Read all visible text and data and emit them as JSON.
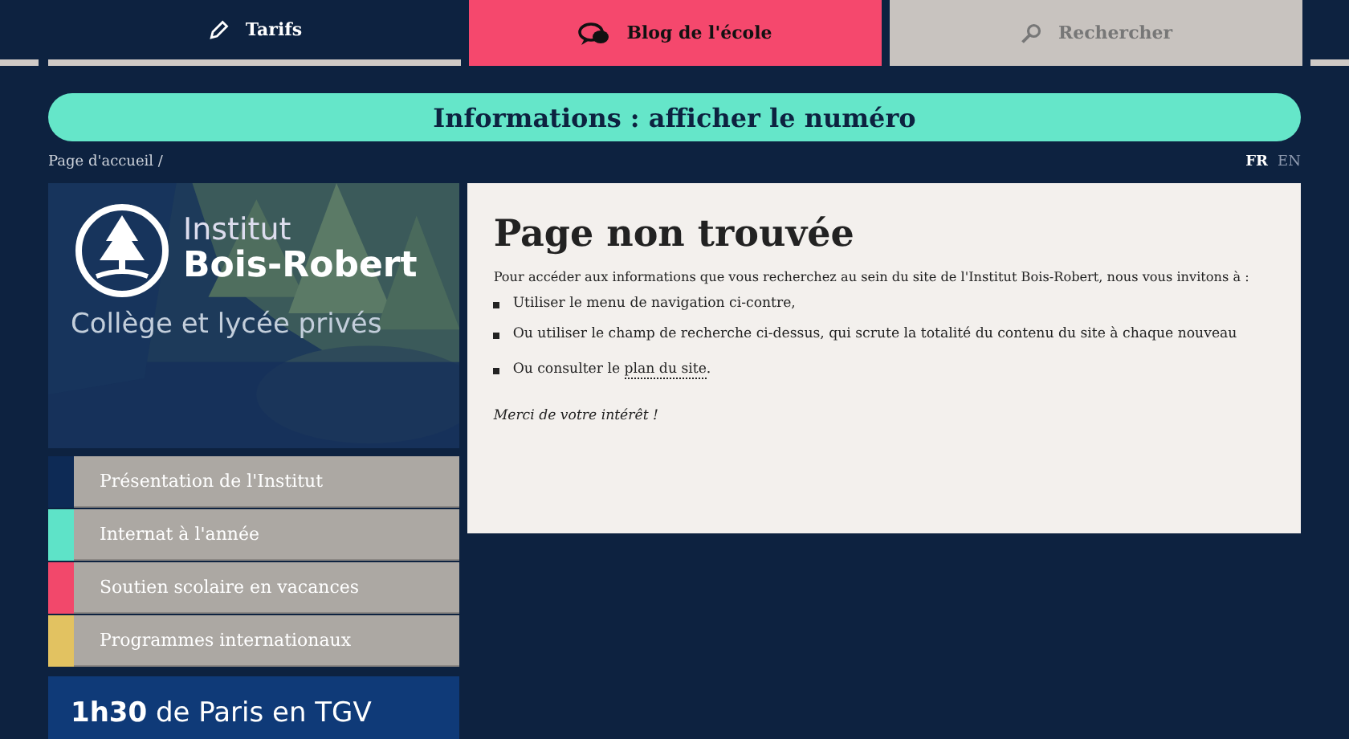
{
  "nav_tabs": [
    {
      "label": "Tarifs",
      "selected": false
    },
    {
      "label": "Blog de l'école",
      "selected": true
    },
    {
      "label": "Rechercher",
      "selected": false
    }
  ],
  "info_button": "Informations : afficher le numéro",
  "breadcrumb": "Page d'accueil /",
  "languages": [
    {
      "label": "FR",
      "selected": true
    },
    {
      "label": "EN",
      "selected": false
    }
  ],
  "sidebar": {
    "brand_top": "Institut",
    "brand_name": "Bois-Robert",
    "tagline": "Collège et lycée privés",
    "menu": [
      {
        "label": "Présentation de l'Institut",
        "color": "#0d2a55"
      },
      {
        "label": "Internat à l'année",
        "color": "#5ee3c8"
      },
      {
        "label": "Soutien scolaire en vacances",
        "color": "#f2486b"
      },
      {
        "label": "Programmes internationaux",
        "color": "#e2c261"
      }
    ],
    "promo": "**1h30** de Paris en TGV"
  },
  "content": {
    "title": "Page non trouvée",
    "intro": "Pour accéder aux informations que vous recherchez au sein du site de l'Institut Bois-Robert, nous vous invitons à :",
    "items": [
      {
        "text": "Utiliser le menu de navigation ci-contre,"
      },
      {
        "text": "Ou utiliser le champ de recherche ci-dessus, qui scrute la totalité du contenu du site à chaque nouveau"
      },
      {
        "text": "Ou consulter le",
        "link": "plan du site",
        "after": "."
      }
    ],
    "closing": "Merci de votre intérêt !"
  }
}
